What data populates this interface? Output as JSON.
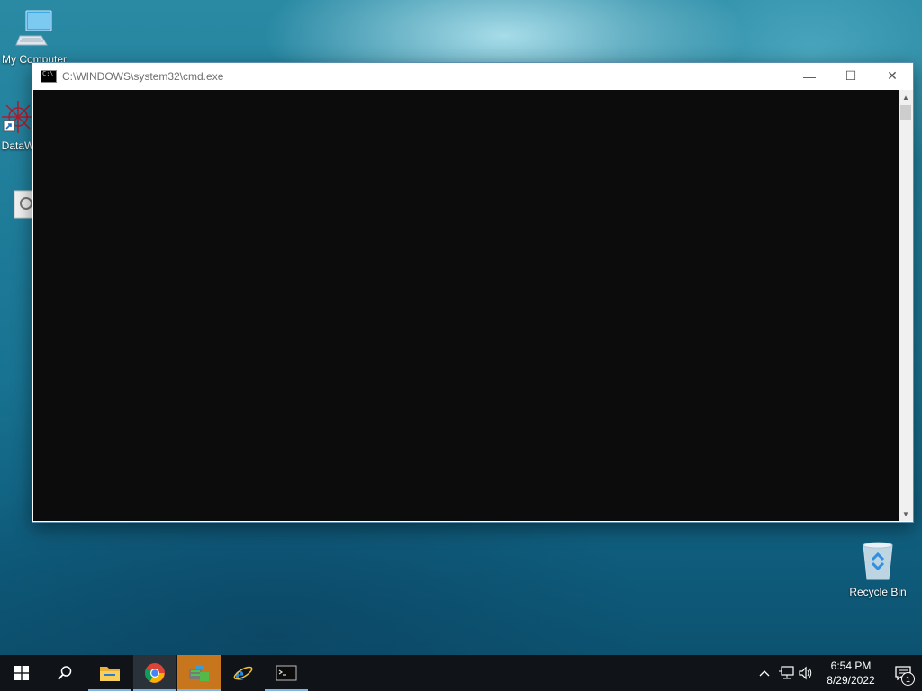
{
  "desktop": {
    "icons": [
      {
        "label": "My Computer",
        "icon": "computer-icon"
      },
      {
        "label": "DataW",
        "icon": "datawin-icon"
      },
      {
        "label": "",
        "icon": "app-icon"
      },
      {
        "label": "Recycle Bin",
        "icon": "recycle-bin-icon"
      }
    ]
  },
  "window": {
    "title": "C:\\WINDOWS\\system32\\cmd.exe",
    "controls": {
      "minimize": "—",
      "maximize": "☐",
      "close": "✕"
    },
    "console_bg": "#0c0c0c"
  },
  "taskbar": {
    "apps": [
      {
        "name": "start",
        "icon": "windows-logo-icon"
      },
      {
        "name": "search",
        "icon": "search-icon"
      },
      {
        "name": "file-explorer",
        "icon": "folder-icon"
      },
      {
        "name": "chrome",
        "icon": "chrome-icon"
      },
      {
        "name": "server-manager",
        "icon": "server-manager-icon"
      },
      {
        "name": "internet-explorer",
        "icon": "ie-icon"
      },
      {
        "name": "command-prompt",
        "icon": "cmd-icon"
      }
    ],
    "tray": {
      "time": "6:54 PM",
      "date": "8/29/2022",
      "notification_count": "1"
    }
  }
}
